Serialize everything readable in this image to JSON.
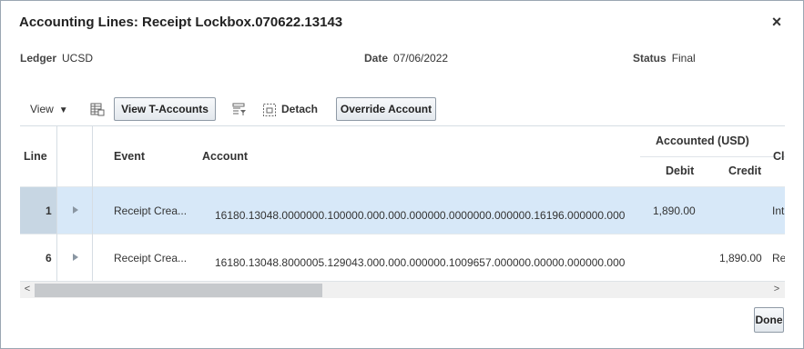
{
  "dialog": {
    "title": "Accounting Lines: Receipt Lockbox.070622.13143",
    "close_label": "×"
  },
  "info": {
    "ledger_label": "Ledger",
    "ledger_value": "UCSD",
    "date_label": "Date",
    "date_value": "07/06/2022",
    "status_label": "Status",
    "status_value": "Final"
  },
  "toolbar": {
    "view_label": "View",
    "view_t_accounts_label": "View T-Accounts",
    "detach_label": "Detach",
    "override_account_label": "Override Account"
  },
  "table": {
    "columns": {
      "line": "Line",
      "event": "Event",
      "account": "Account",
      "accounted_group": "Accounted (USD)",
      "debit": "Debit",
      "credit": "Credit",
      "next_col": "Cl"
    },
    "rows": [
      {
        "line": "1",
        "event": "Receipt Crea...",
        "account": "16180.13048.0000000.100000.000.000.000000.0000000.000000.16196.000000.000",
        "debit": "1,890.00",
        "credit": "",
        "next": "Int",
        "selected": true
      },
      {
        "line": "6",
        "event": "Receipt Crea...",
        "account": "16180.13048.8000005.129043.000.000.000000.1009657.000000.00000.000000.000",
        "debit": "",
        "credit": "1,890.00",
        "next": "Re",
        "selected": false
      }
    ]
  },
  "scrollbar": {
    "left_arrow": "<",
    "right_arrow": ">"
  },
  "footer": {
    "done_label": "Done"
  },
  "colors": {
    "selected_row": "#d7e8f8",
    "dialog_border": "#9aa6b2"
  }
}
